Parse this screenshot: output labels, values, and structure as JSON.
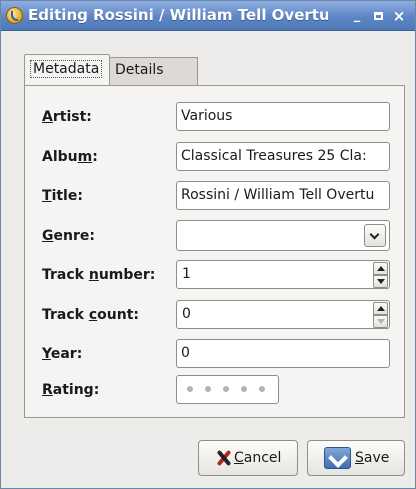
{
  "window": {
    "title": "Editing Rossini / William Tell Overtur",
    "minimize_symbol": "_",
    "close_symbol": "×"
  },
  "tabs": [
    {
      "label": "Metadata",
      "active": true
    },
    {
      "label": "Details",
      "active": false
    }
  ],
  "fields": {
    "artist": {
      "pre": "",
      "mnemonic": "A",
      "post": "rtist:",
      "value": "Various"
    },
    "album": {
      "pre": "Albu",
      "mnemonic": "m",
      "post": ":",
      "value": "Classical Treasures 25 Cla:"
    },
    "title": {
      "pre": "",
      "mnemonic": "T",
      "post": "itle:",
      "value": "Rossini / William Tell Overtu"
    },
    "genre": {
      "pre": "",
      "mnemonic": "G",
      "post": "enre:",
      "value": ""
    },
    "track_number": {
      "pre": "Track ",
      "mnemonic": "n",
      "post": "umber:",
      "value": "1"
    },
    "track_count": {
      "pre": "Track ",
      "mnemonic": "c",
      "post": "ount:",
      "value": "0"
    },
    "year": {
      "pre": "",
      "mnemonic": "Y",
      "post": "ear:",
      "value": "0"
    },
    "rating": {
      "pre": "",
      "mnemonic": "R",
      "post": "ating:",
      "stars_total": 5,
      "stars_filled": 0
    }
  },
  "buttons": {
    "cancel": {
      "mnemonic": "C",
      "rest": "ancel"
    },
    "save": {
      "mnemonic": "S",
      "rest": "ave"
    }
  },
  "icons": {
    "app": "app-icon",
    "cancel": "cancel-x-icon",
    "save": "save-arrow-icon",
    "genre_dropdown": "chevron-down-icon"
  }
}
